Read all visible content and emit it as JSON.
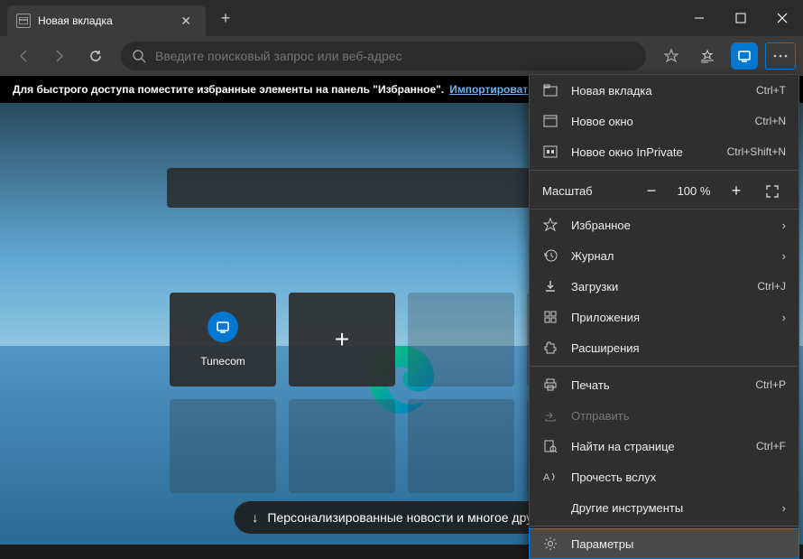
{
  "tab": {
    "title": "Новая вкладка"
  },
  "omnibox": {
    "placeholder": "Введите поисковый запрос или веб-адрес"
  },
  "fav_prompt": {
    "text": "Для быстрого доступа поместите избранные элементы на панель \"Избранное\".",
    "link": "Импортировать из…"
  },
  "tiles": [
    {
      "label": "Tunecom"
    }
  ],
  "news_pill": "Персонализированные новости и многое другое",
  "menu": {
    "new_tab": {
      "label": "Новая вкладка",
      "shortcut": "Ctrl+T"
    },
    "new_window": {
      "label": "Новое окно",
      "shortcut": "Ctrl+N"
    },
    "new_inprivate": {
      "label": "Новое окно InPrivate",
      "shortcut": "Ctrl+Shift+N"
    },
    "zoom": {
      "label": "Масштаб",
      "value": "100 %"
    },
    "favorites": {
      "label": "Избранное"
    },
    "history": {
      "label": "Журнал"
    },
    "downloads": {
      "label": "Загрузки",
      "shortcut": "Ctrl+J"
    },
    "apps": {
      "label": "Приложения"
    },
    "extensions": {
      "label": "Расширения"
    },
    "print": {
      "label": "Печать",
      "shortcut": "Ctrl+P"
    },
    "share": {
      "label": "Отправить"
    },
    "find": {
      "label": "Найти на странице",
      "shortcut": "Ctrl+F"
    },
    "read_aloud": {
      "label": "Прочесть вслух"
    },
    "more_tools": {
      "label": "Другие инструменты"
    },
    "settings": {
      "label": "Параметры"
    }
  }
}
